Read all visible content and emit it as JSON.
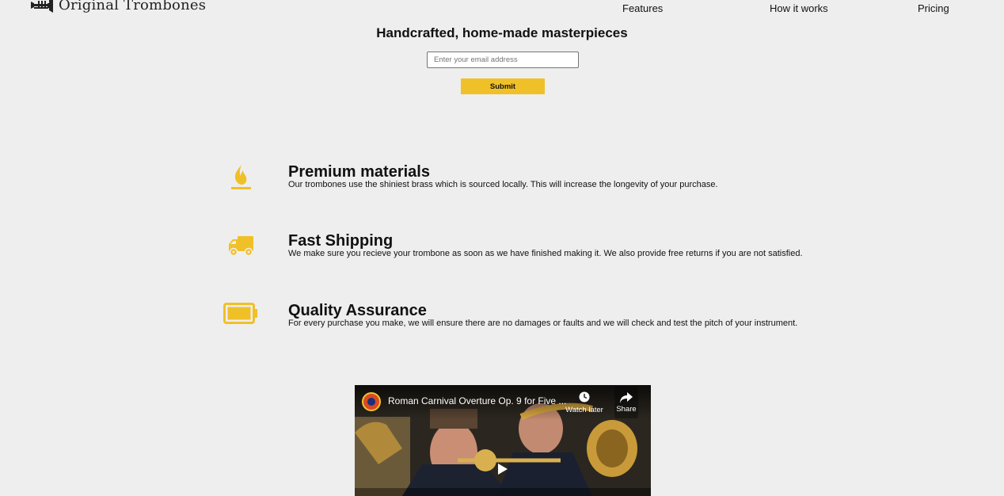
{
  "header": {
    "logo_text": "Original Trombones",
    "nav": [
      {
        "label": "Features"
      },
      {
        "label": "How it works"
      },
      {
        "label": "Pricing"
      }
    ]
  },
  "hero": {
    "title": "Handcrafted, home-made masterpieces",
    "email_placeholder": "Enter your email address",
    "email_value": "",
    "submit_label": "Submit"
  },
  "features": [
    {
      "icon": "fire-icon",
      "title": "Premium materials",
      "description": "Our trombones use the shiniest brass which is sourced locally. This will increase the longevity of your purchase."
    },
    {
      "icon": "truck-icon",
      "title": "Fast Shipping",
      "description": "We make sure you recieve your trombone as soon as we have finished making it. We also provide free returns if you are not satisfied."
    },
    {
      "icon": "battery-icon",
      "title": "Quality Assurance",
      "description": "For every purchase you make, we will ensure there are no damages or faults and we will check and test the pitch of your instrument."
    }
  ],
  "video": {
    "title": "Roman Carnival Overture Op. 9 for Five ...",
    "watch_later_label": "Watch later",
    "share_label": "Share"
  },
  "colors": {
    "accent": "#f0c028",
    "background": "#eeeeee",
    "text": "#111111"
  }
}
